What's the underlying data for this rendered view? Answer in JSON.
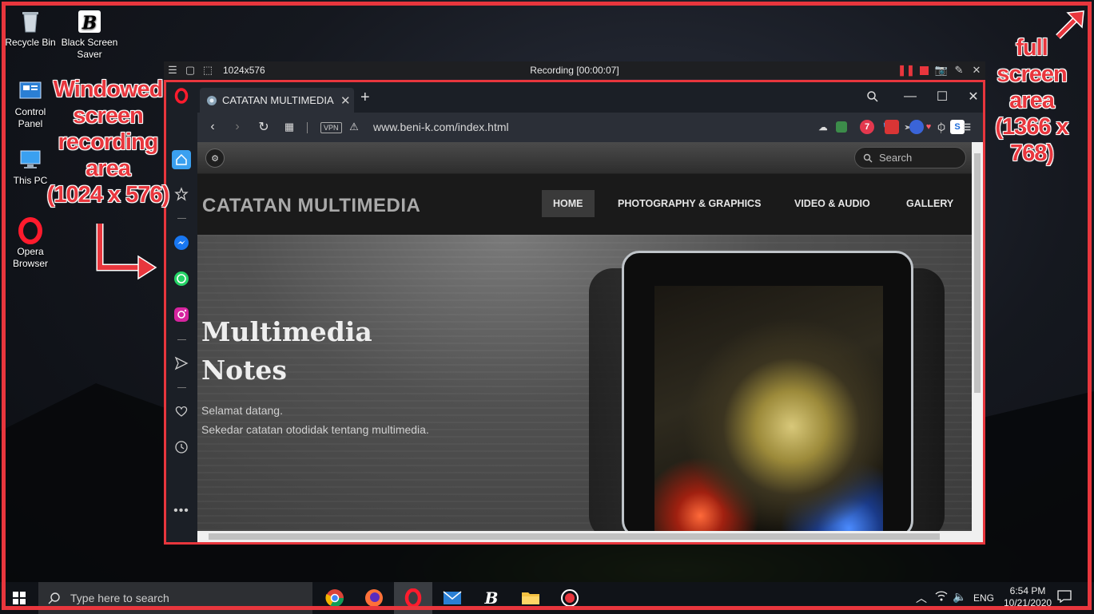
{
  "desktop": {
    "icons": [
      {
        "label": "Recycle Bin"
      },
      {
        "label": "Black Screen Saver"
      },
      {
        "label": "Control Panel"
      },
      {
        "label": "This PC"
      },
      {
        "label": "Opera Browser"
      }
    ]
  },
  "annotations": {
    "windowed": [
      "Windowed",
      "screen",
      "recording",
      "area",
      "(1024 x 576)"
    ],
    "full": [
      "full",
      "screen",
      "area",
      "(1366 x",
      "768)"
    ]
  },
  "recorder": {
    "size_label": "1024x576",
    "status": "Recording [00:00:07]"
  },
  "browser": {
    "tab_title": "CATATAN MULTIMEDIA - M",
    "new_tab": "+",
    "vpn": "VPN",
    "url": "www.beni-k.com/index.html"
  },
  "site": {
    "search_placeholder": "Search",
    "title": "CATATAN MULTIMEDIA",
    "nav": [
      {
        "label": "HOME",
        "active": true
      },
      {
        "label": "PHOTOGRAPHY & GRAPHICS",
        "active": false
      },
      {
        "label": "VIDEO & AUDIO",
        "active": false
      },
      {
        "label": "GALLERY",
        "active": false
      }
    ],
    "hero_title_1": "Multimedia",
    "hero_title_2": "Notes",
    "hero_line_1": "Selamat datang.",
    "hero_line_2": "Sekedar catatan otodidak tentang multimedia."
  },
  "taskbar": {
    "search_placeholder": "Type here to search",
    "language": "ENG",
    "time": "6:54 PM",
    "date": "10/21/2020"
  },
  "colors": {
    "annotation_red": "#e8363d",
    "opera_red": "#ff1b2d"
  }
}
